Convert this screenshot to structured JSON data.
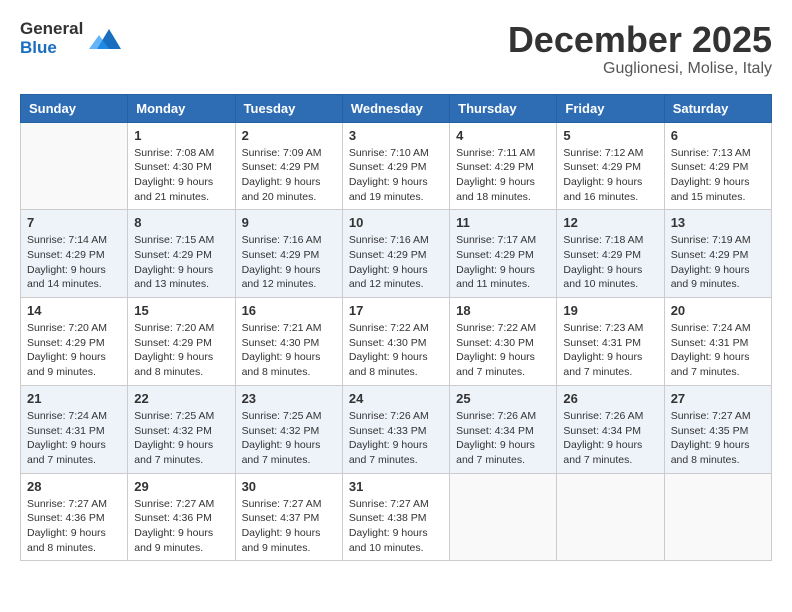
{
  "header": {
    "logo_general": "General",
    "logo_blue": "Blue",
    "month_title": "December 2025",
    "location": "Guglionesi, Molise, Italy"
  },
  "weekdays": [
    "Sunday",
    "Monday",
    "Tuesday",
    "Wednesday",
    "Thursday",
    "Friday",
    "Saturday"
  ],
  "weeks": [
    [
      {
        "day": "",
        "info": ""
      },
      {
        "day": "1",
        "info": "Sunrise: 7:08 AM\nSunset: 4:30 PM\nDaylight: 9 hours\nand 21 minutes."
      },
      {
        "day": "2",
        "info": "Sunrise: 7:09 AM\nSunset: 4:29 PM\nDaylight: 9 hours\nand 20 minutes."
      },
      {
        "day": "3",
        "info": "Sunrise: 7:10 AM\nSunset: 4:29 PM\nDaylight: 9 hours\nand 19 minutes."
      },
      {
        "day": "4",
        "info": "Sunrise: 7:11 AM\nSunset: 4:29 PM\nDaylight: 9 hours\nand 18 minutes."
      },
      {
        "day": "5",
        "info": "Sunrise: 7:12 AM\nSunset: 4:29 PM\nDaylight: 9 hours\nand 16 minutes."
      },
      {
        "day": "6",
        "info": "Sunrise: 7:13 AM\nSunset: 4:29 PM\nDaylight: 9 hours\nand 15 minutes."
      }
    ],
    [
      {
        "day": "7",
        "info": "Sunrise: 7:14 AM\nSunset: 4:29 PM\nDaylight: 9 hours\nand 14 minutes."
      },
      {
        "day": "8",
        "info": "Sunrise: 7:15 AM\nSunset: 4:29 PM\nDaylight: 9 hours\nand 13 minutes."
      },
      {
        "day": "9",
        "info": "Sunrise: 7:16 AM\nSunset: 4:29 PM\nDaylight: 9 hours\nand 12 minutes."
      },
      {
        "day": "10",
        "info": "Sunrise: 7:16 AM\nSunset: 4:29 PM\nDaylight: 9 hours\nand 12 minutes."
      },
      {
        "day": "11",
        "info": "Sunrise: 7:17 AM\nSunset: 4:29 PM\nDaylight: 9 hours\nand 11 minutes."
      },
      {
        "day": "12",
        "info": "Sunrise: 7:18 AM\nSunset: 4:29 PM\nDaylight: 9 hours\nand 10 minutes."
      },
      {
        "day": "13",
        "info": "Sunrise: 7:19 AM\nSunset: 4:29 PM\nDaylight: 9 hours\nand 9 minutes."
      }
    ],
    [
      {
        "day": "14",
        "info": "Sunrise: 7:20 AM\nSunset: 4:29 PM\nDaylight: 9 hours\nand 9 minutes."
      },
      {
        "day": "15",
        "info": "Sunrise: 7:20 AM\nSunset: 4:29 PM\nDaylight: 9 hours\nand 8 minutes."
      },
      {
        "day": "16",
        "info": "Sunrise: 7:21 AM\nSunset: 4:30 PM\nDaylight: 9 hours\nand 8 minutes."
      },
      {
        "day": "17",
        "info": "Sunrise: 7:22 AM\nSunset: 4:30 PM\nDaylight: 9 hours\nand 8 minutes."
      },
      {
        "day": "18",
        "info": "Sunrise: 7:22 AM\nSunset: 4:30 PM\nDaylight: 9 hours\nand 7 minutes."
      },
      {
        "day": "19",
        "info": "Sunrise: 7:23 AM\nSunset: 4:31 PM\nDaylight: 9 hours\nand 7 minutes."
      },
      {
        "day": "20",
        "info": "Sunrise: 7:24 AM\nSunset: 4:31 PM\nDaylight: 9 hours\nand 7 minutes."
      }
    ],
    [
      {
        "day": "21",
        "info": "Sunrise: 7:24 AM\nSunset: 4:31 PM\nDaylight: 9 hours\nand 7 minutes."
      },
      {
        "day": "22",
        "info": "Sunrise: 7:25 AM\nSunset: 4:32 PM\nDaylight: 9 hours\nand 7 minutes."
      },
      {
        "day": "23",
        "info": "Sunrise: 7:25 AM\nSunset: 4:32 PM\nDaylight: 9 hours\nand 7 minutes."
      },
      {
        "day": "24",
        "info": "Sunrise: 7:26 AM\nSunset: 4:33 PM\nDaylight: 9 hours\nand 7 minutes."
      },
      {
        "day": "25",
        "info": "Sunrise: 7:26 AM\nSunset: 4:34 PM\nDaylight: 9 hours\nand 7 minutes."
      },
      {
        "day": "26",
        "info": "Sunrise: 7:26 AM\nSunset: 4:34 PM\nDaylight: 9 hours\nand 7 minutes."
      },
      {
        "day": "27",
        "info": "Sunrise: 7:27 AM\nSunset: 4:35 PM\nDaylight: 9 hours\nand 8 minutes."
      }
    ],
    [
      {
        "day": "28",
        "info": "Sunrise: 7:27 AM\nSunset: 4:36 PM\nDaylight: 9 hours\nand 8 minutes."
      },
      {
        "day": "29",
        "info": "Sunrise: 7:27 AM\nSunset: 4:36 PM\nDaylight: 9 hours\nand 9 minutes."
      },
      {
        "day": "30",
        "info": "Sunrise: 7:27 AM\nSunset: 4:37 PM\nDaylight: 9 hours\nand 9 minutes."
      },
      {
        "day": "31",
        "info": "Sunrise: 7:27 AM\nSunset: 4:38 PM\nDaylight: 9 hours\nand 10 minutes."
      },
      {
        "day": "",
        "info": ""
      },
      {
        "day": "",
        "info": ""
      },
      {
        "day": "",
        "info": ""
      }
    ]
  ]
}
